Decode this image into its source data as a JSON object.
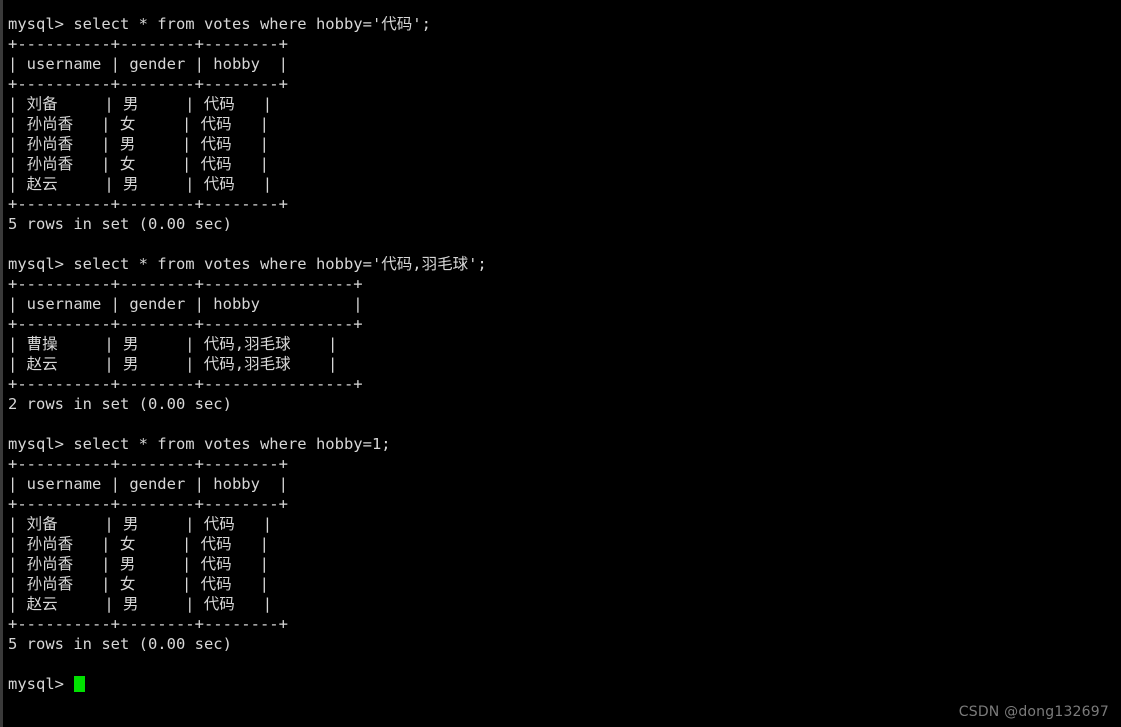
{
  "terminal": {
    "title": "mysql command line client",
    "background_color": "#000000",
    "text_color": "#d7d7d7",
    "cursor_color": "#00e000",
    "prompt": "mysql> ",
    "lines": [
      "mysql> select * from votes where hobby='代码';",
      "+----------+--------+--------+",
      "| username | gender | hobby  |",
      "+----------+--------+--------+",
      "| 刘备     | 男     | 代码   |",
      "| 孙尚香   | 女     | 代码   |",
      "| 孙尚香   | 男     | 代码   |",
      "| 孙尚香   | 女     | 代码   |",
      "| 赵云     | 男     | 代码   |",
      "+----------+--------+--------+",
      "5 rows in set (0.00 sec)",
      "",
      "mysql> select * from votes where hobby='代码,羽毛球';",
      "+----------+--------+----------------+",
      "| username | gender | hobby          |",
      "+----------+--------+----------------+",
      "| 曹操     | 男     | 代码,羽毛球    |",
      "| 赵云     | 男     | 代码,羽毛球    |",
      "+----------+--------+----------------+",
      "2 rows in set (0.00 sec)",
      "",
      "mysql> select * from votes where hobby=1;",
      "+----------+--------+--------+",
      "| username | gender | hobby  |",
      "+----------+--------+--------+",
      "| 刘备     | 男     | 代码   |",
      "| 孙尚香   | 女     | 代码   |",
      "| 孙尚香   | 男     | 代码   |",
      "| 孙尚香   | 女     | 代码   |",
      "| 赵云     | 男     | 代码   |",
      "+----------+--------+--------+",
      "5 rows in set (0.00 sec)",
      ""
    ],
    "final_prompt": "mysql> "
  },
  "queries": [
    {
      "command": "select * from votes where hobby='代码';",
      "columns": [
        "username",
        "gender",
        "hobby"
      ],
      "rows": [
        [
          "刘备",
          "男",
          "代码"
        ],
        [
          "孙尚香",
          "女",
          "代码"
        ],
        [
          "孙尚香",
          "男",
          "代码"
        ],
        [
          "孙尚香",
          "女",
          "代码"
        ],
        [
          "赵云",
          "男",
          "代码"
        ]
      ],
      "result_status": "5 rows in set (0.00 sec)"
    },
    {
      "command": "select * from votes where hobby='代码,羽毛球';",
      "columns": [
        "username",
        "gender",
        "hobby"
      ],
      "rows": [
        [
          "曹操",
          "男",
          "代码,羽毛球"
        ],
        [
          "赵云",
          "男",
          "代码,羽毛球"
        ]
      ],
      "result_status": "2 rows in set (0.00 sec)"
    },
    {
      "command": "select * from votes where hobby=1;",
      "columns": [
        "username",
        "gender",
        "hobby"
      ],
      "rows": [
        [
          "刘备",
          "男",
          "代码"
        ],
        [
          "孙尚香",
          "女",
          "代码"
        ],
        [
          "孙尚香",
          "男",
          "代码"
        ],
        [
          "孙尚香",
          "女",
          "代码"
        ],
        [
          "赵云",
          "男",
          "代码"
        ]
      ],
      "result_status": "5 rows in set (0.00 sec)"
    }
  ],
  "watermark": {
    "text": "CSDN @dong132697"
  }
}
